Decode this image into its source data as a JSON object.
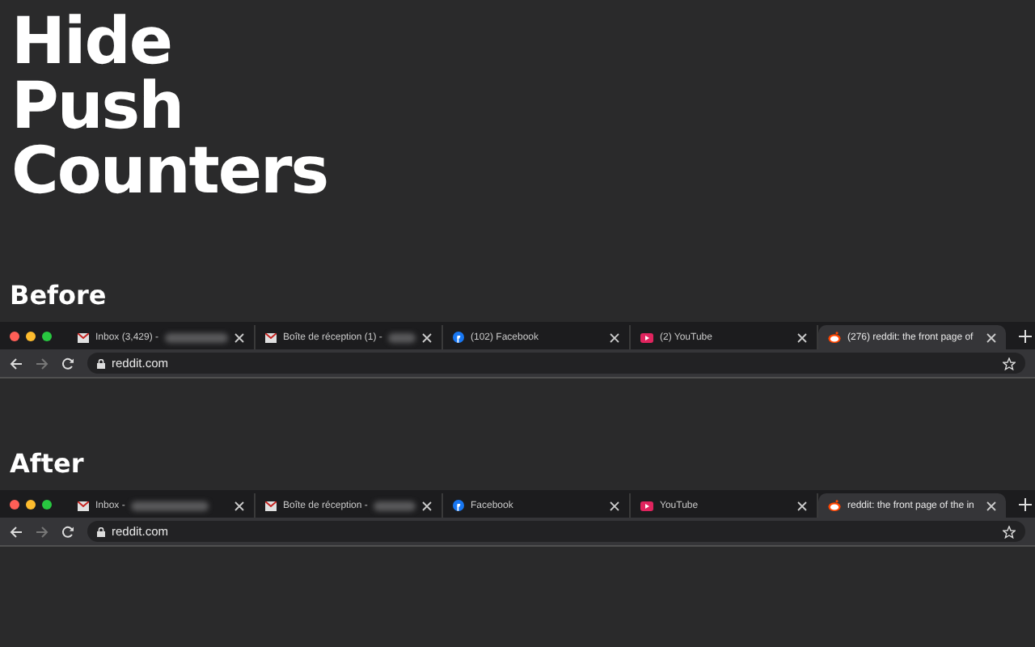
{
  "heading": [
    "Hide",
    "Push",
    "Counters"
  ],
  "sections": [
    {
      "label": "Before",
      "browser": {
        "url": "reddit.com",
        "tabs": [
          {
            "kind": "mail",
            "title": "Inbox (3,429) -",
            "redacted": true,
            "selected": false
          },
          {
            "kind": "mail",
            "title": "Boîte de réception (1) -",
            "redacted": true,
            "selected": false
          },
          {
            "kind": "facebook",
            "title": "(102) Facebook",
            "redacted": false,
            "selected": false
          },
          {
            "kind": "youtube",
            "title": "(2) YouTube",
            "redacted": false,
            "selected": false
          },
          {
            "kind": "reddit",
            "title": "(276) reddit: the front page of",
            "redacted": false,
            "selected": true
          }
        ]
      }
    },
    {
      "label": "After",
      "browser": {
        "url": "reddit.com",
        "tabs": [
          {
            "kind": "mail",
            "title": "Inbox -",
            "redacted": true,
            "selected": false
          },
          {
            "kind": "mail",
            "title": "Boîte de réception -",
            "redacted": true,
            "selected": false
          },
          {
            "kind": "facebook",
            "title": "Facebook",
            "redacted": false,
            "selected": false
          },
          {
            "kind": "youtube",
            "title": "YouTube",
            "redacted": false,
            "selected": false
          },
          {
            "kind": "reddit",
            "title": "reddit: the front page of the in",
            "redacted": false,
            "selected": true
          }
        ]
      }
    }
  ]
}
